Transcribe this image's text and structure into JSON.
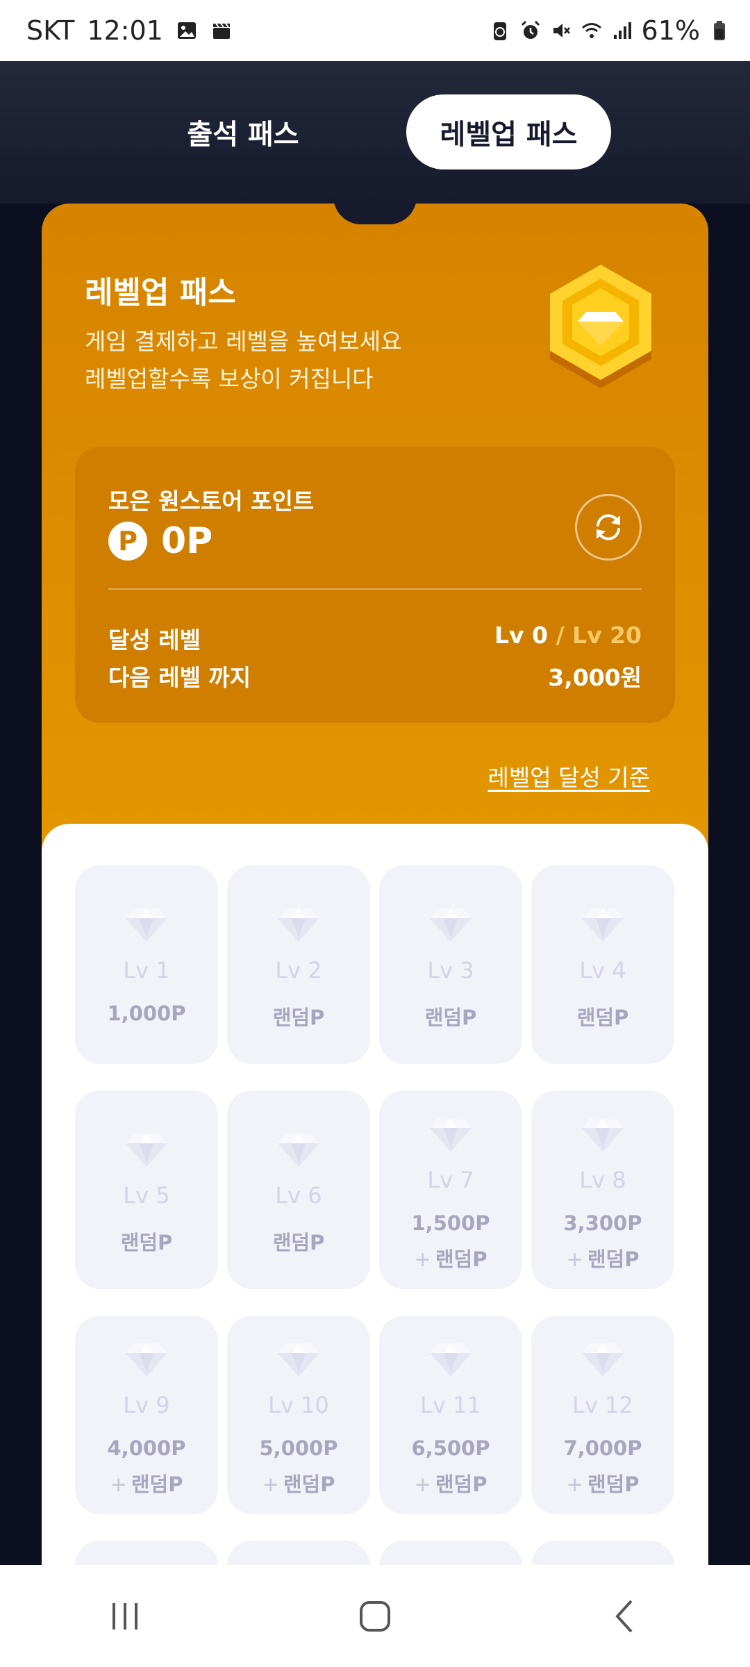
{
  "status_bar": {
    "carrier": "SKT",
    "time": "12:01",
    "battery": "61%",
    "icons": [
      "gallery-icon",
      "clapper-icon",
      "battery-saver-icon",
      "alarm-icon",
      "mute-icon",
      "wifi-icon",
      "signal-icon",
      "battery-icon"
    ]
  },
  "tabs": {
    "attendance": "출석 패스",
    "levelup": "레벨업 패스",
    "active": "levelup"
  },
  "hero": {
    "title": "레벨업 패스",
    "subtitle_1": "게임 결제하고 레벨을 높여보세요",
    "subtitle_2": "레벨업할수록 보상이 커집니다",
    "badge_icon": "hexagon-diamond-badge-icon"
  },
  "points": {
    "label": "모은 원스토어 포인트",
    "coin_symbol": "P",
    "value": "0P",
    "refresh_icon": "refresh-icon",
    "achieved_label": "달성 레벨",
    "achieved_current": "Lv 0",
    "achieved_sep": " / ",
    "achieved_max": "Lv 20",
    "next_label": "다음 레벨 까지",
    "next_value": "3,000원"
  },
  "criteria_link": "레벨업 달성 기준",
  "levels": [
    {
      "name": "Lv 1",
      "reward": "1,000P",
      "bonus": ""
    },
    {
      "name": "Lv 2",
      "reward": "랜덤P",
      "bonus": ""
    },
    {
      "name": "Lv 3",
      "reward": "랜덤P",
      "bonus": ""
    },
    {
      "name": "Lv 4",
      "reward": "랜덤P",
      "bonus": ""
    },
    {
      "name": "Lv 5",
      "reward": "랜덤P",
      "bonus": ""
    },
    {
      "name": "Lv 6",
      "reward": "랜덤P",
      "bonus": ""
    },
    {
      "name": "Lv 7",
      "reward": "1,500P",
      "bonus": "랜덤P"
    },
    {
      "name": "Lv 8",
      "reward": "3,300P",
      "bonus": "랜덤P"
    },
    {
      "name": "Lv 9",
      "reward": "4,000P",
      "bonus": "랜덤P"
    },
    {
      "name": "Lv 10",
      "reward": "5,000P",
      "bonus": "랜덤P"
    },
    {
      "name": "Lv 11",
      "reward": "6,500P",
      "bonus": "랜덤P"
    },
    {
      "name": "Lv 12",
      "reward": "7,000P",
      "bonus": "랜덤P"
    },
    {
      "name": "",
      "reward": "",
      "bonus": ""
    },
    {
      "name": "",
      "reward": "",
      "bonus": ""
    },
    {
      "name": "",
      "reward": "",
      "bonus": ""
    },
    {
      "name": "",
      "reward": "",
      "bonus": ""
    }
  ],
  "bonus_prefix": "+",
  "colors": {
    "accent_orange": "#d68300",
    "accent_yellow": "#f0b000",
    "dark_bg": "#161a2c",
    "locked_card": "#f2f2f9"
  },
  "nav": {
    "recent_icon": "recent-apps-icon",
    "home_icon": "home-icon",
    "back_icon": "back-icon"
  }
}
